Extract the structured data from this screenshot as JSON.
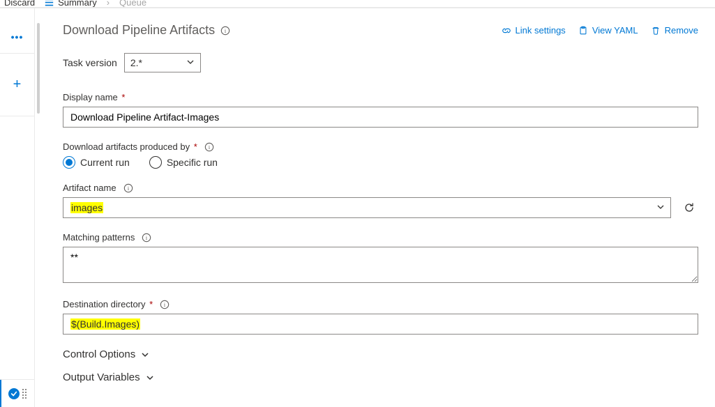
{
  "breadcrumb": {
    "discard": "Discard",
    "summary": "Summary",
    "queue": "Queue"
  },
  "header": {
    "title": "Download Pipeline Artifacts",
    "actions": {
      "link": "Link settings",
      "yaml": "View YAML",
      "remove": "Remove"
    }
  },
  "task_version": {
    "label": "Task version",
    "value": "2.*"
  },
  "display_name": {
    "label": "Display name",
    "value": "Download Pipeline Artifact-Images"
  },
  "produced_by": {
    "label": "Download artifacts produced by",
    "current": "Current run",
    "specific": "Specific run"
  },
  "artifact_name": {
    "label": "Artifact name",
    "value": "images"
  },
  "patterns": {
    "label": "Matching patterns",
    "value": "**"
  },
  "dest": {
    "label": "Destination directory",
    "value": "$(Build.Images)"
  },
  "sections": {
    "control": "Control Options",
    "output": "Output Variables"
  }
}
